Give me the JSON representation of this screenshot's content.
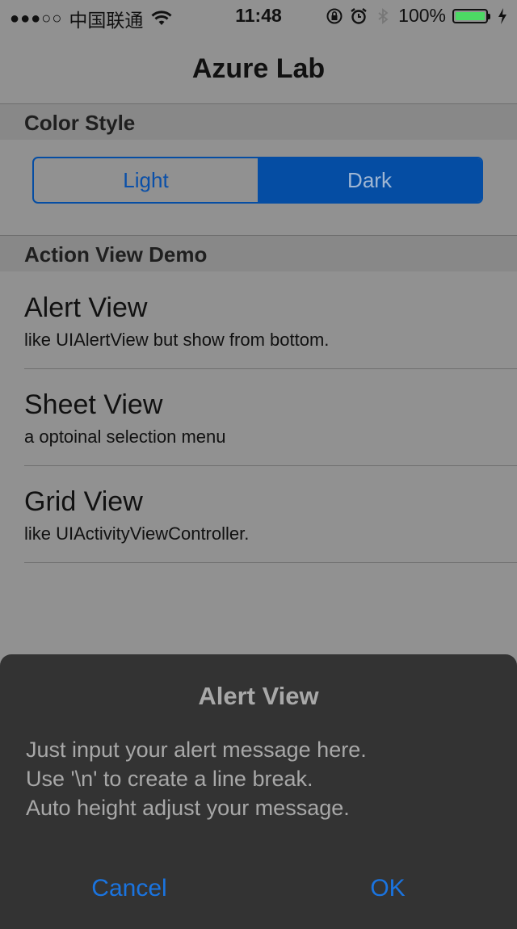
{
  "status_bar": {
    "signal": "●●●○○",
    "carrier": "中国联通",
    "time": "11:48",
    "battery": "100%",
    "battery_level": 1.0,
    "icons": [
      "wifi-icon",
      "rotation-lock-icon",
      "alarm-icon",
      "bluetooth-icon",
      "battery-icon",
      "charging-icon"
    ]
  },
  "navbar": {
    "title": "Azure Lab"
  },
  "color_style": {
    "header": "Color Style",
    "segments": [
      "Light",
      "Dark"
    ],
    "selected": "Dark",
    "accent": "#054da3"
  },
  "action_demo": {
    "header": "Action View Demo",
    "items": [
      {
        "title": "Alert View",
        "subtitle": "like UIAlertView but show from bottom."
      },
      {
        "title": "Sheet View",
        "subtitle": "a optoinal selection menu"
      },
      {
        "title": "Grid View",
        "subtitle": "like UIActivityViewController."
      }
    ]
  },
  "alert": {
    "title": "Alert View",
    "message_lines": [
      "Just input your alert message here.",
      "Use '\\n' to create a line break.",
      "Auto height adjust your message."
    ],
    "cancel_label": "Cancel",
    "ok_label": "OK",
    "button_color": "#1a74e0"
  }
}
